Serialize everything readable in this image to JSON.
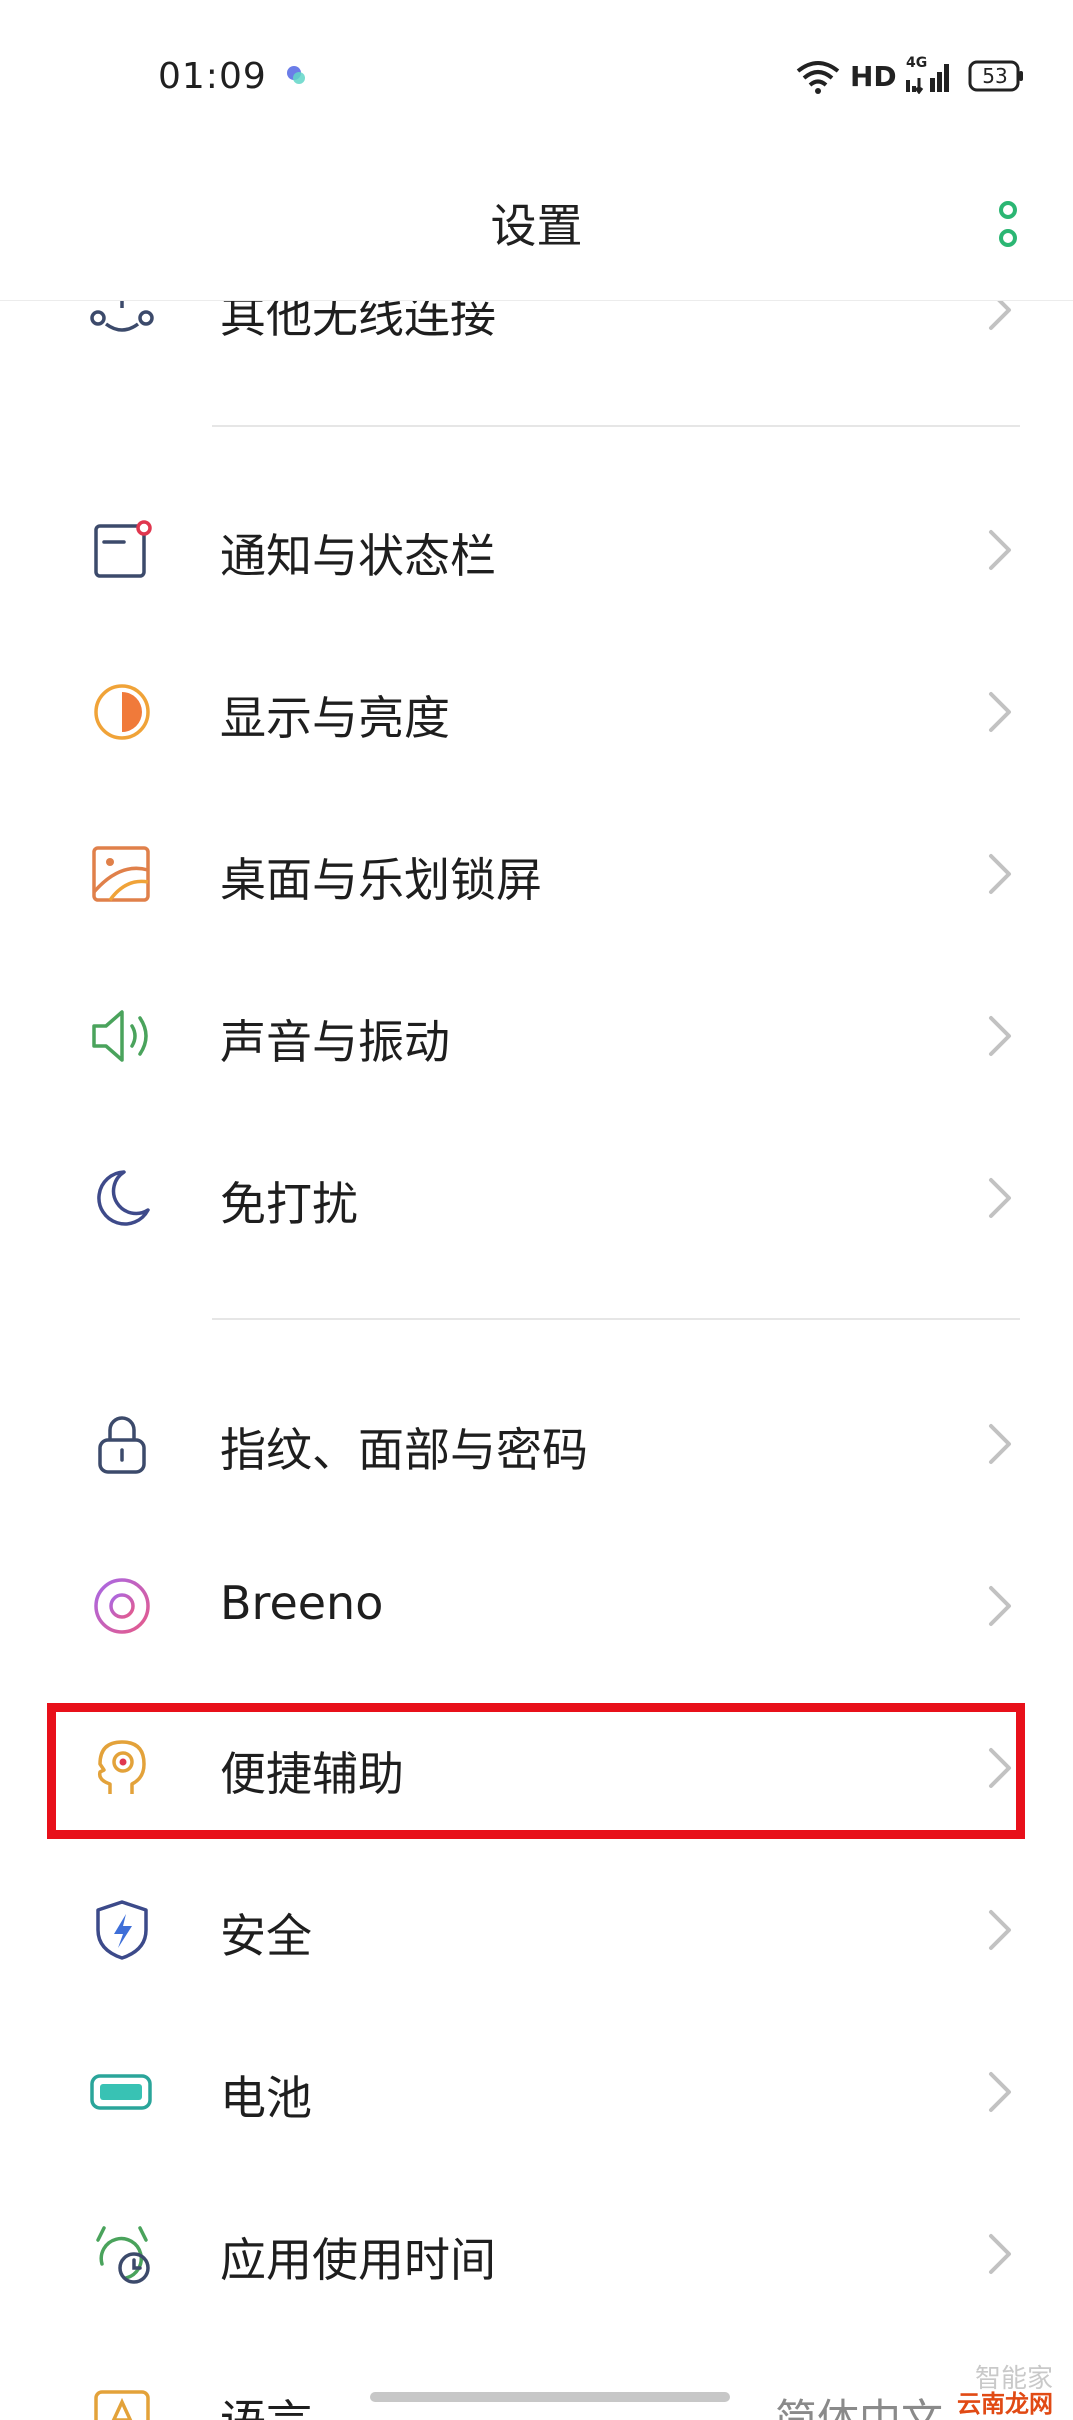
{
  "status_bar": {
    "time": "01:09",
    "network": "HD",
    "signal_type": "4G",
    "battery": "53"
  },
  "header": {
    "title": "设置"
  },
  "settings": {
    "items": [
      {
        "label": "其他无线连接",
        "icon": "connection-icon"
      },
      {
        "label": "通知与状态栏",
        "icon": "notification-icon"
      },
      {
        "label": "显示与亮度",
        "icon": "brightness-icon"
      },
      {
        "label": "桌面与乐划锁屏",
        "icon": "wallpaper-icon"
      },
      {
        "label": "声音与振动",
        "icon": "speaker-icon"
      },
      {
        "label": "免打扰",
        "icon": "moon-icon"
      },
      {
        "label": "指纹、面部与密码",
        "icon": "lock-icon"
      },
      {
        "label": "Breeno",
        "icon": "breeno-icon"
      },
      {
        "label": "便捷辅助",
        "icon": "assist-head-icon"
      },
      {
        "label": "安全",
        "icon": "shield-icon"
      },
      {
        "label": "电池",
        "icon": "battery-icon"
      },
      {
        "label": "应用使用时间",
        "icon": "alarm-clock-icon"
      },
      {
        "label": "语言",
        "icon": "language-icon"
      }
    ],
    "partial_right_text": "简体中文"
  },
  "highlighted_item": "便捷辅助",
  "watermark": {
    "line1": "智能家",
    "line2": "云南龙网"
  },
  "colors": {
    "accent_green": "#2bb673",
    "highlight_red": "#e8101a",
    "chevron": "#c2c2c2"
  }
}
